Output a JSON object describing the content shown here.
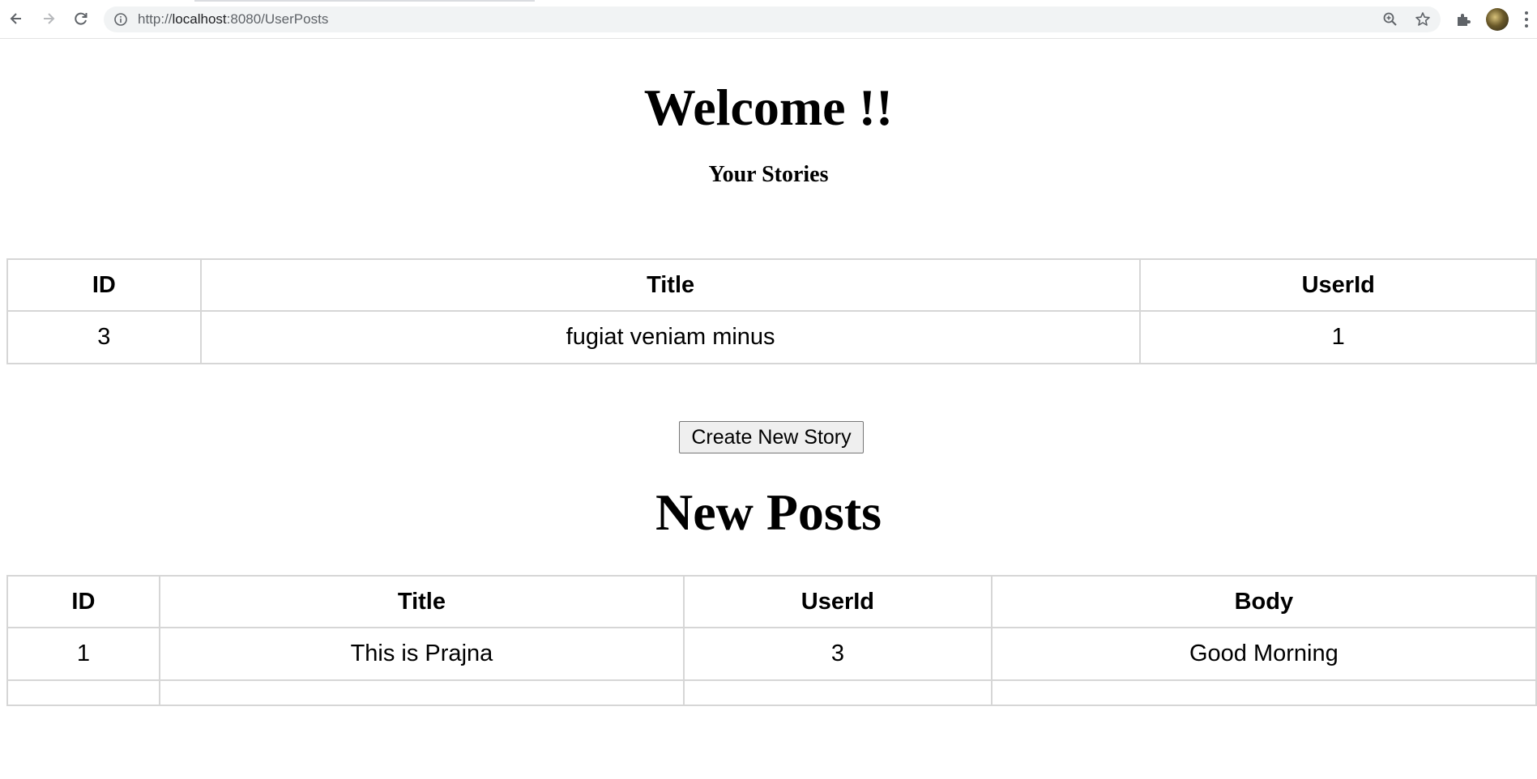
{
  "browser": {
    "url_prefix": "http://",
    "url_host": "localhost",
    "url_rest": ":8080/UserPosts"
  },
  "page": {
    "welcome_heading": "Welcome !!",
    "stories_heading": "Your Stories",
    "create_button_label": "Create New Story",
    "new_posts_heading": "New Posts"
  },
  "stories_table": {
    "headers": {
      "id": "ID",
      "title": "Title",
      "userid": "UserId"
    },
    "rows": [
      {
        "id": "3",
        "title": "fugiat veniam minus",
        "userid": "1"
      }
    ]
  },
  "posts_table": {
    "headers": {
      "id": "ID",
      "title": "Title",
      "userid": "UserId",
      "body": "Body"
    },
    "rows": [
      {
        "id": "1",
        "title": "This is Prajna",
        "userid": "3",
        "body": "Good Morning"
      }
    ]
  }
}
